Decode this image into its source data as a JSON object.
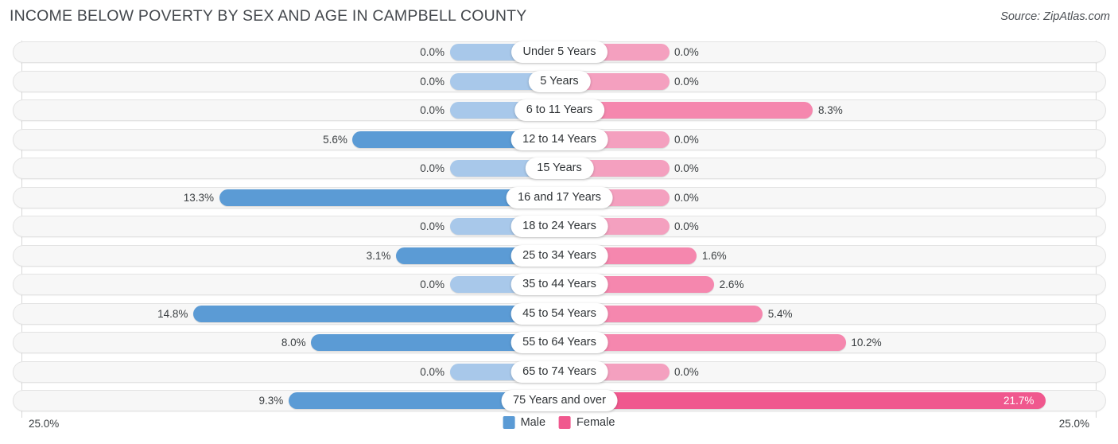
{
  "header": {
    "title": "INCOME BELOW POVERTY BY SEX AND AGE IN CAMPBELL COUNTY",
    "source": "Source: ZipAtlas.com"
  },
  "axis": {
    "left_label": "25.0%",
    "right_label": "25.0%"
  },
  "legend": {
    "items": [
      {
        "label": "Male",
        "color": "#5b9bd5"
      },
      {
        "label": "Female",
        "color": "#f0588e"
      }
    ]
  },
  "colors": {
    "male": "#5b9bd5",
    "male_zero": "#a8c8ea",
    "female": "#f0588e",
    "female_zero": "#f4a0bf",
    "female_mid": "#f587ae",
    "track": "#f7f7f7",
    "track_border": "#e3e3e3"
  },
  "chart_data": {
    "type": "bar",
    "orientation": "horizontal-diverging",
    "title": "INCOME BELOW POVERTY BY SEX AND AGE IN CAMPBELL COUNTY",
    "xlabel": "",
    "ylabel": "",
    "xlim": [
      25.0,
      25.0
    ],
    "grid": false,
    "legend_position": "bottom-center",
    "categories": [
      "Under 5 Years",
      "5 Years",
      "6 to 11 Years",
      "12 to 14 Years",
      "15 Years",
      "16 and 17 Years",
      "18 to 24 Years",
      "25 to 34 Years",
      "35 to 44 Years",
      "45 to 54 Years",
      "55 to 64 Years",
      "65 to 74 Years",
      "75 Years and over"
    ],
    "series": [
      {
        "name": "Male",
        "values": [
          0.0,
          0.0,
          0.0,
          5.6,
          0.0,
          13.3,
          0.0,
          3.1,
          0.0,
          14.8,
          8.0,
          0.0,
          9.3
        ],
        "labels": [
          "0.0%",
          "0.0%",
          "0.0%",
          "5.6%",
          "0.0%",
          "13.3%",
          "0.0%",
          "3.1%",
          "0.0%",
          "14.8%",
          "8.0%",
          "0.0%",
          "9.3%"
        ]
      },
      {
        "name": "Female",
        "values": [
          0.0,
          0.0,
          8.3,
          0.0,
          0.0,
          0.0,
          0.0,
          1.6,
          2.6,
          5.4,
          10.2,
          0.0,
          21.7
        ],
        "labels": [
          "0.0%",
          "0.0%",
          "8.3%",
          "0.0%",
          "0.0%",
          "0.0%",
          "0.0%",
          "1.6%",
          "2.6%",
          "5.4%",
          "10.2%",
          "0.0%",
          "21.7%"
        ]
      }
    ]
  }
}
